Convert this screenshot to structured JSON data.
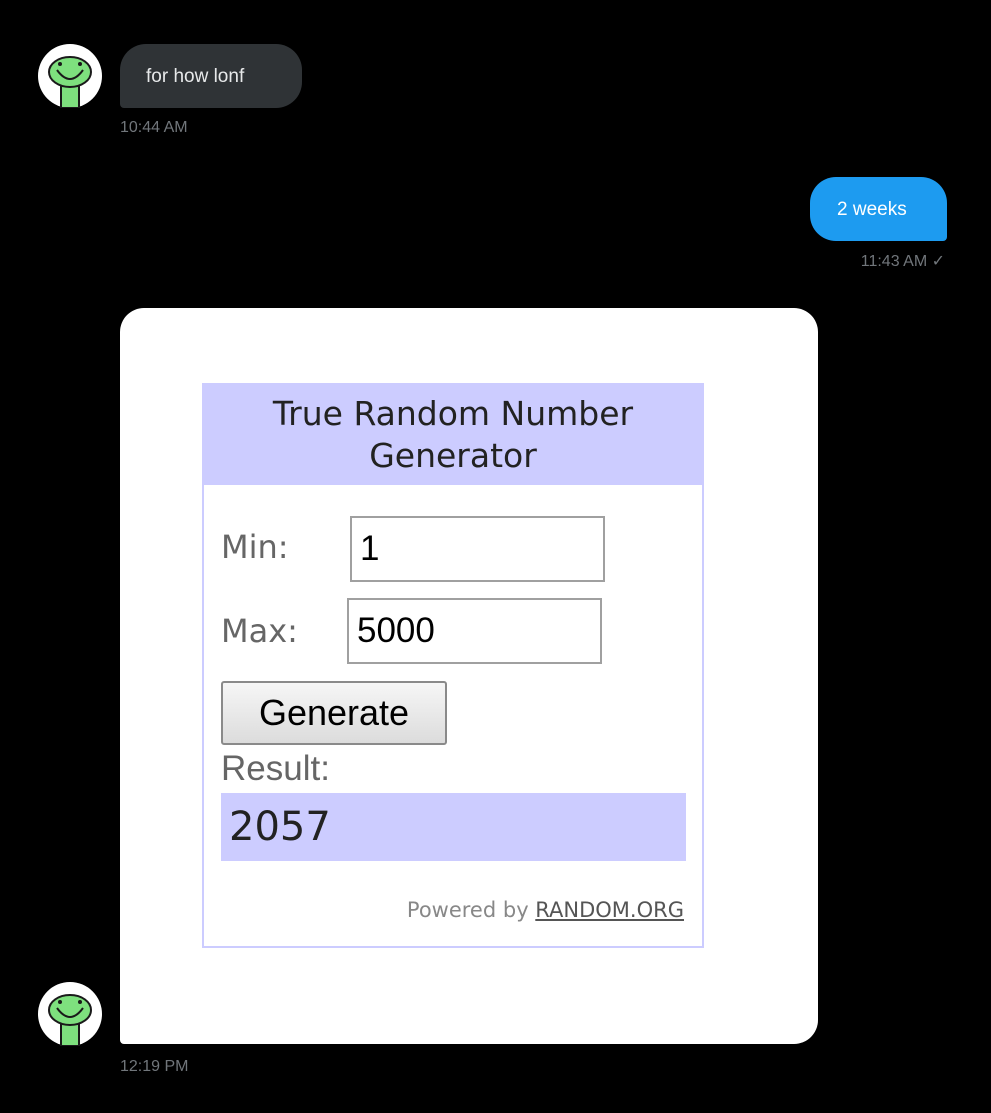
{
  "messages": {
    "first": {
      "text": "for how lonf",
      "time": "10:44 AM"
    },
    "second": {
      "text": "2 weeks",
      "time": "11:43 AM ✓"
    },
    "third": {
      "time": "12:19 PM"
    }
  },
  "widget": {
    "title": "True Random Number Generator",
    "min_label": "Min:",
    "min_value": "1",
    "max_label": "Max:",
    "max_value": "5000",
    "generate_label": "Generate",
    "result_label": "Result:",
    "result_value": "2057",
    "powered_prefix": "Powered by ",
    "powered_link": "RANDOM.ORG"
  },
  "colors": {
    "background": "#000000",
    "incoming_bubble": "#2f3336",
    "outgoing_bubble": "#1d9bf0",
    "widget_accent": "#ccccff",
    "avatar_green": "#7ee07e"
  },
  "icons": {
    "avatar": "green-frog-avatar-icon"
  }
}
